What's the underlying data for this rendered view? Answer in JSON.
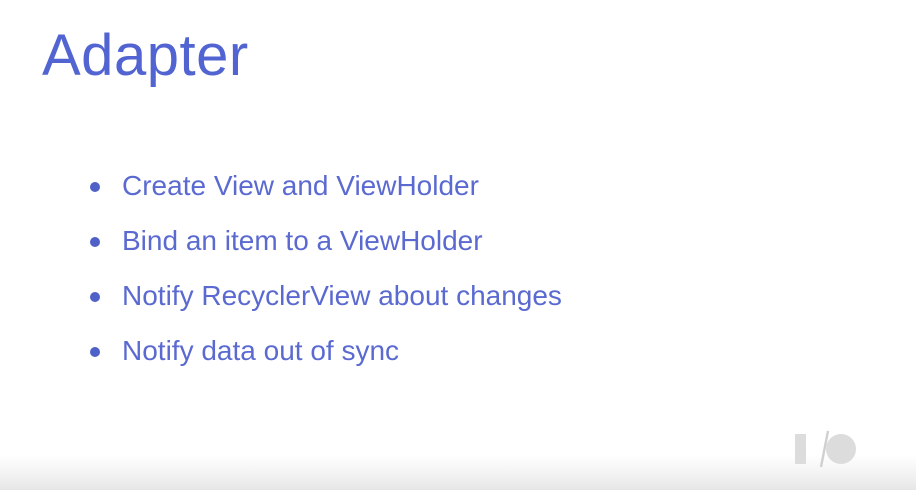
{
  "slide": {
    "title": "Adapter",
    "bullets": [
      "Create View and ViewHolder",
      "Bind an item to a ViewHolder",
      "Notify RecyclerView about changes",
      "Notify data out of sync"
    ],
    "colors": {
      "title": "#5164d1",
      "bullet_text": "#5a6ad0",
      "bullet_dot": "#4f60c8",
      "logo": "#dcdcdc"
    },
    "logo_icon": "google-io-logo-icon"
  }
}
